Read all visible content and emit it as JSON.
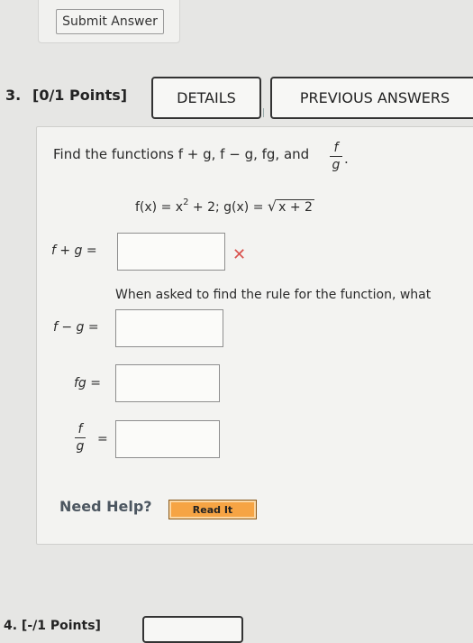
{
  "previous": {
    "submit_label": "Submit Answer"
  },
  "question": {
    "number": "3.",
    "points": "[0/1 Points]",
    "details_label": "DETAILS",
    "previous_answers_label": "PREVIOUS ANSWERS",
    "instruction": "Find the functions f + g, f − g, fg, and",
    "quotient_num": "f",
    "quotient_den": "g",
    "quotient_suffix": ".",
    "given_f": "f(x) = x",
    "given_f_exp": "2",
    "given_f_rest": " + 2; g(x) = ",
    "given_g_radicand": "x + 2",
    "sum_label": "f + g =",
    "diff_label": "f − g =",
    "prod_label": "fg =",
    "quot_eq": "=",
    "feedback": "When asked to find the rule for the function, what",
    "wrong_mark": "✕",
    "need_help": "Need Help?",
    "read_it_label": "Read It"
  },
  "next_question": {
    "text": "4. [-/1 Points]"
  }
}
